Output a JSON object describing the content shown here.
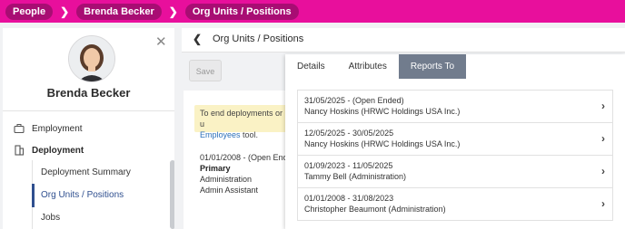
{
  "breadcrumb": [
    "People",
    "Brenda Becker",
    "Org Units / Positions"
  ],
  "profile": {
    "name": "Brenda Becker"
  },
  "nav": {
    "employment": "Employment",
    "deployment": "Deployment",
    "sub": [
      "Deployment Summary",
      "Org Units / Positions",
      "Jobs"
    ]
  },
  "main": {
    "title": "Org Units / Positions",
    "save_label": "Save",
    "info_text": "To end deployments or u",
    "info_link": "Employees",
    "info_tail": " tool.",
    "entry": {
      "date": "01/01/2008 - (Open End",
      "primary": "Primary",
      "unit": "Administration",
      "position": "Admin Assistant"
    }
  },
  "popover": {
    "tabs": [
      "Details",
      "Attributes",
      "Reports To"
    ],
    "active_tab": "Reports To",
    "reports": [
      {
        "period": "31/05/2025 - (Open Ended)",
        "person": "Nancy Hoskins (HRWC Holdings USA Inc.)"
      },
      {
        "period": "12/05/2025 - 30/05/2025",
        "person": "Nancy Hoskins (HRWC Holdings USA Inc.)"
      },
      {
        "period": "01/09/2023 - 11/05/2025",
        "person": "Tammy Bell (Administration)"
      },
      {
        "period": "01/01/2008 - 31/08/2023",
        "person": "Christopher Beaumont (Administration)"
      }
    ]
  },
  "colors": {
    "topbar": "#e80f9c",
    "crumb": "#a80d73",
    "active_tab": "#717c8d",
    "accent": "#2f4f8f"
  }
}
